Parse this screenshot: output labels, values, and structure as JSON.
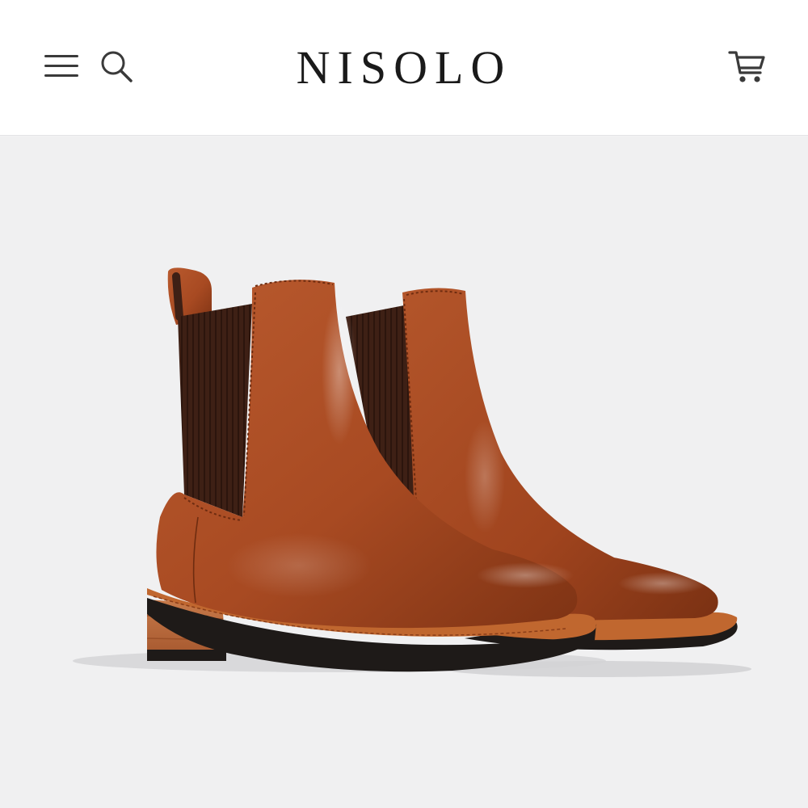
{
  "header": {
    "brand": "NISOLO",
    "menu_icon": "hamburger-menu-icon",
    "search_icon": "search-icon",
    "cart_icon": "shopping-cart-icon"
  },
  "product_image": {
    "subject": "chelsea-boot-pair",
    "colors": {
      "leather": "#a84a22",
      "elastic": "#3e2015",
      "sole": "#1e1a18",
      "welt": "#c0672f",
      "heel_wood": "#b8673a",
      "background": "#f0f0f1"
    }
  }
}
